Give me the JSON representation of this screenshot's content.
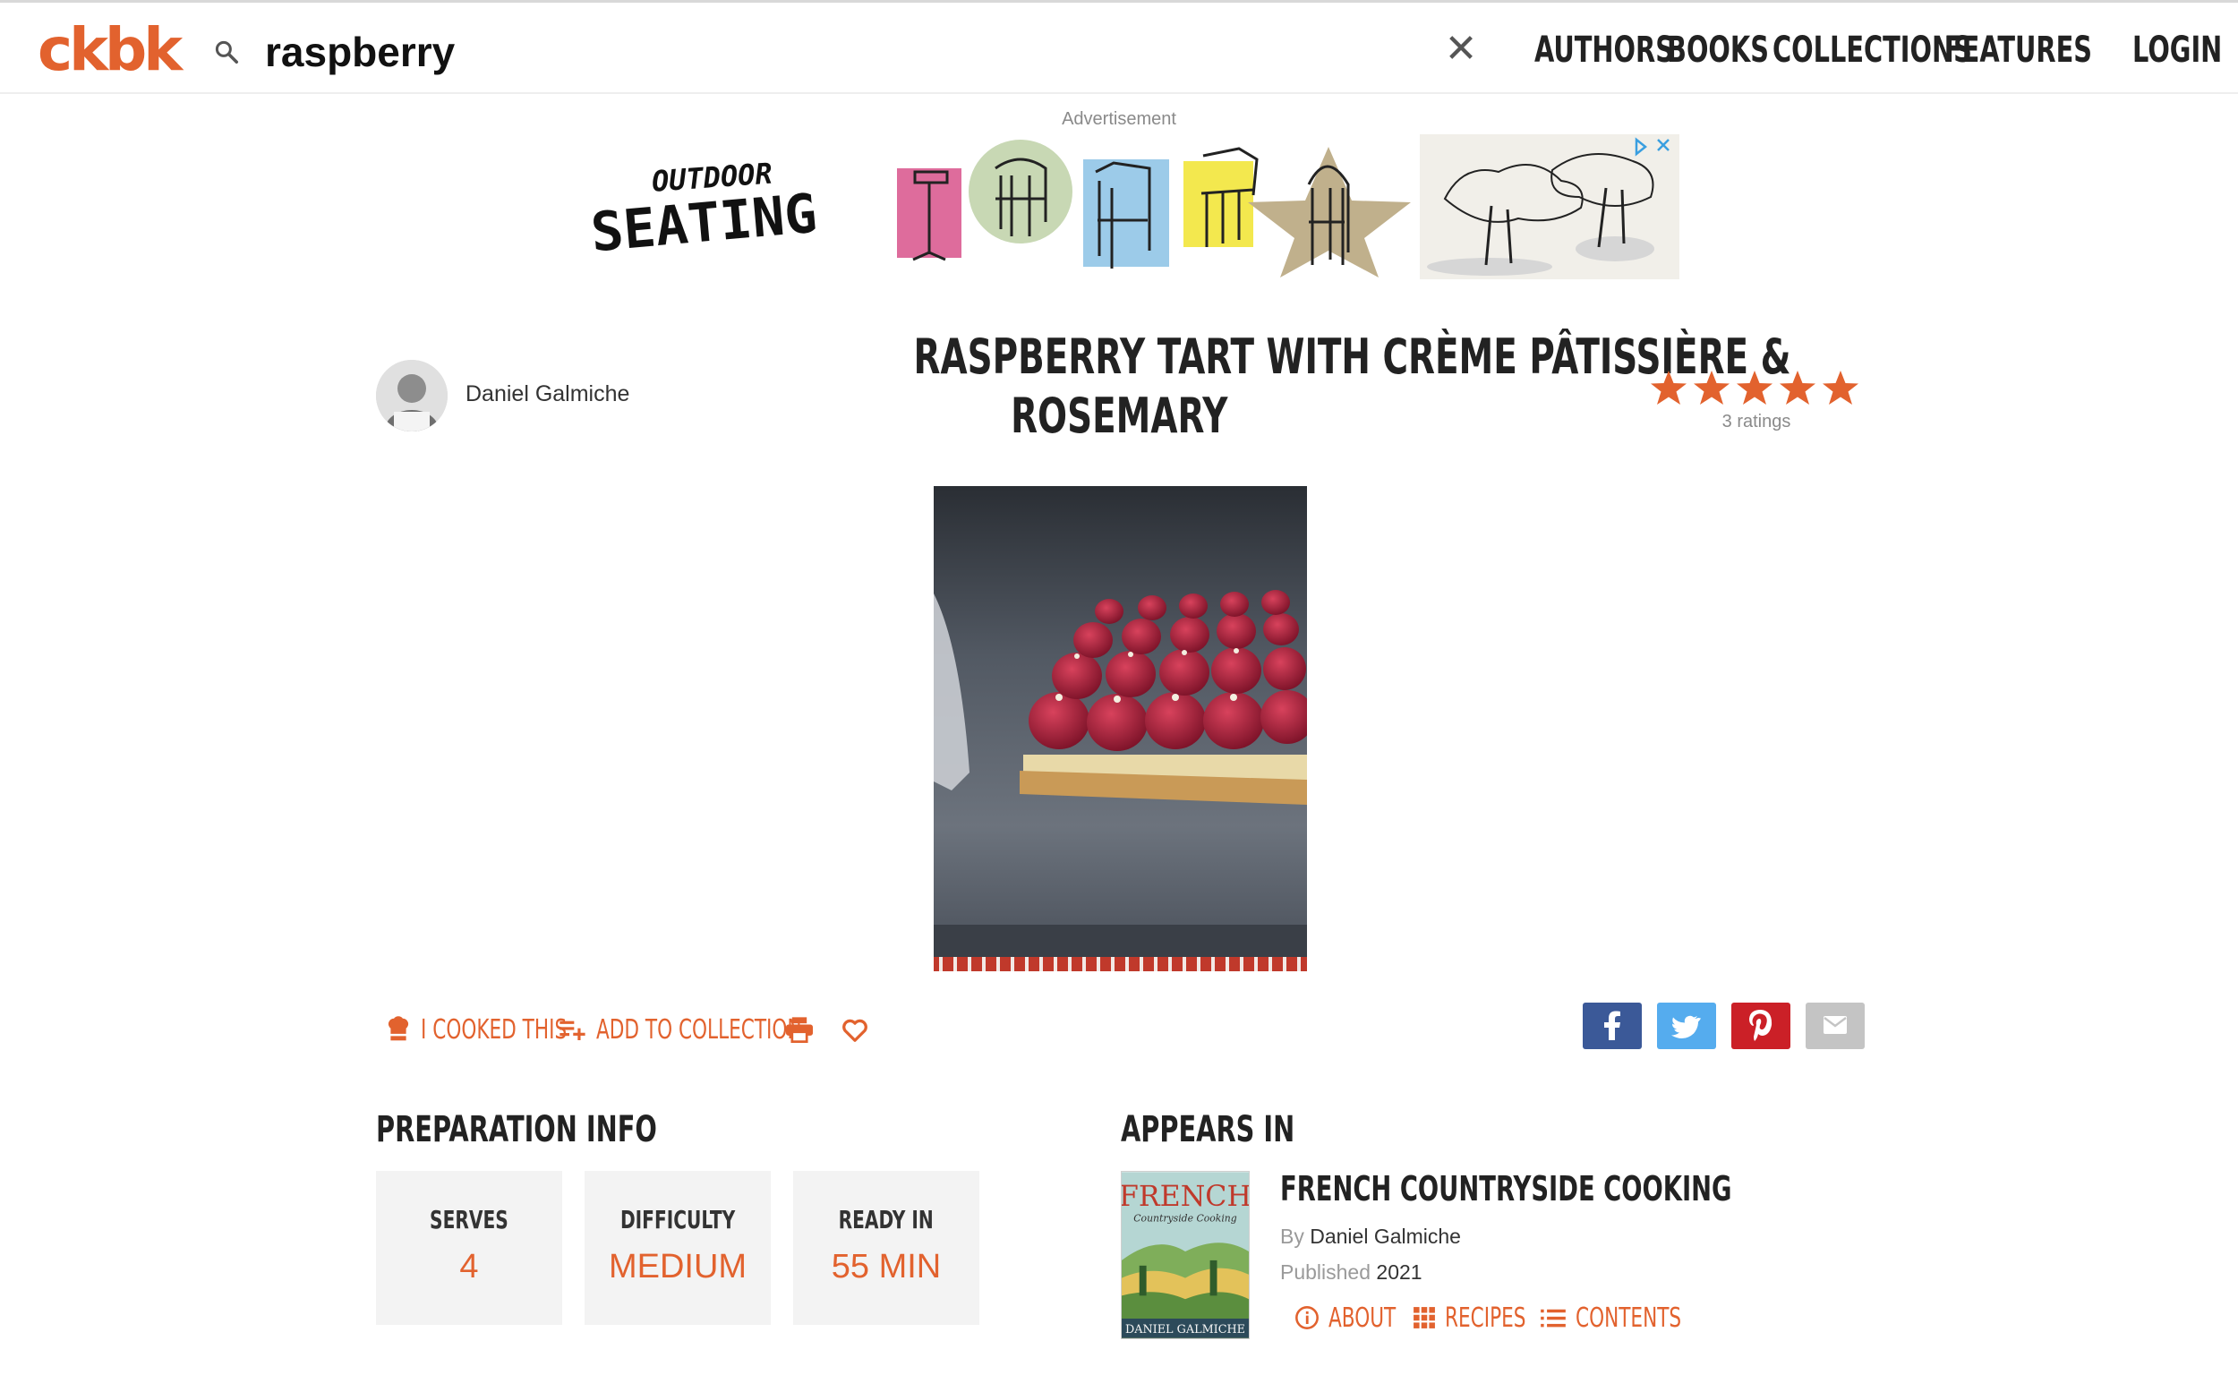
{
  "header": {
    "logo": "ckbk",
    "search_value": "raspberry",
    "nav": [
      "AUTHORS",
      "BOOKS",
      "COLLECTIONS",
      "FEATURES",
      "LOGIN"
    ]
  },
  "ad": {
    "label": "Advertisement",
    "headline_top": "OUTDOOR",
    "headline_bottom": "SEATING"
  },
  "recipe": {
    "author": "Daniel Galmiche",
    "title_line1": "RASPBERRY TART WITH CRÈME PÂTISSIÈRE &",
    "title_line2": "ROSEMARY",
    "rating_stars": 5,
    "ratings_text": "3 ratings"
  },
  "actions": {
    "cooked": "I COOKED THIS",
    "add_collection": "ADD TO COLLECTION"
  },
  "prep": {
    "title": "PREPARATION INFO",
    "items": [
      {
        "label": "SERVES",
        "value": "4"
      },
      {
        "label": "DIFFICULTY",
        "value": "MEDIUM"
      },
      {
        "label": "READY IN",
        "value": "55 MIN"
      }
    ]
  },
  "appears_in": {
    "title": "APPEARS IN",
    "book_title": "FRENCH COUNTRYSIDE COOKING",
    "by_label": "By",
    "author": "Daniel Galmiche",
    "published_label": "Published",
    "year": "2021",
    "cover_title": "FRENCH",
    "cover_subtitle": "Countryside Cooking",
    "cover_author": "DANIEL GALMICHE",
    "links": [
      "ABOUT",
      "RECIPES",
      "CONTENTS"
    ]
  },
  "colors": {
    "accent": "#e2622e",
    "facebook": "#3b5998",
    "twitter": "#55acee",
    "pinterest": "#cb2027",
    "email": "#c4c4c4"
  },
  "icons": [
    "search-icon",
    "close-icon",
    "star-icon",
    "chef-hat-icon",
    "playlist-add-icon",
    "print-icon",
    "heart-icon",
    "facebook-icon",
    "twitter-icon",
    "pinterest-icon",
    "email-icon",
    "info-icon",
    "grid-icon",
    "list-icon"
  ]
}
